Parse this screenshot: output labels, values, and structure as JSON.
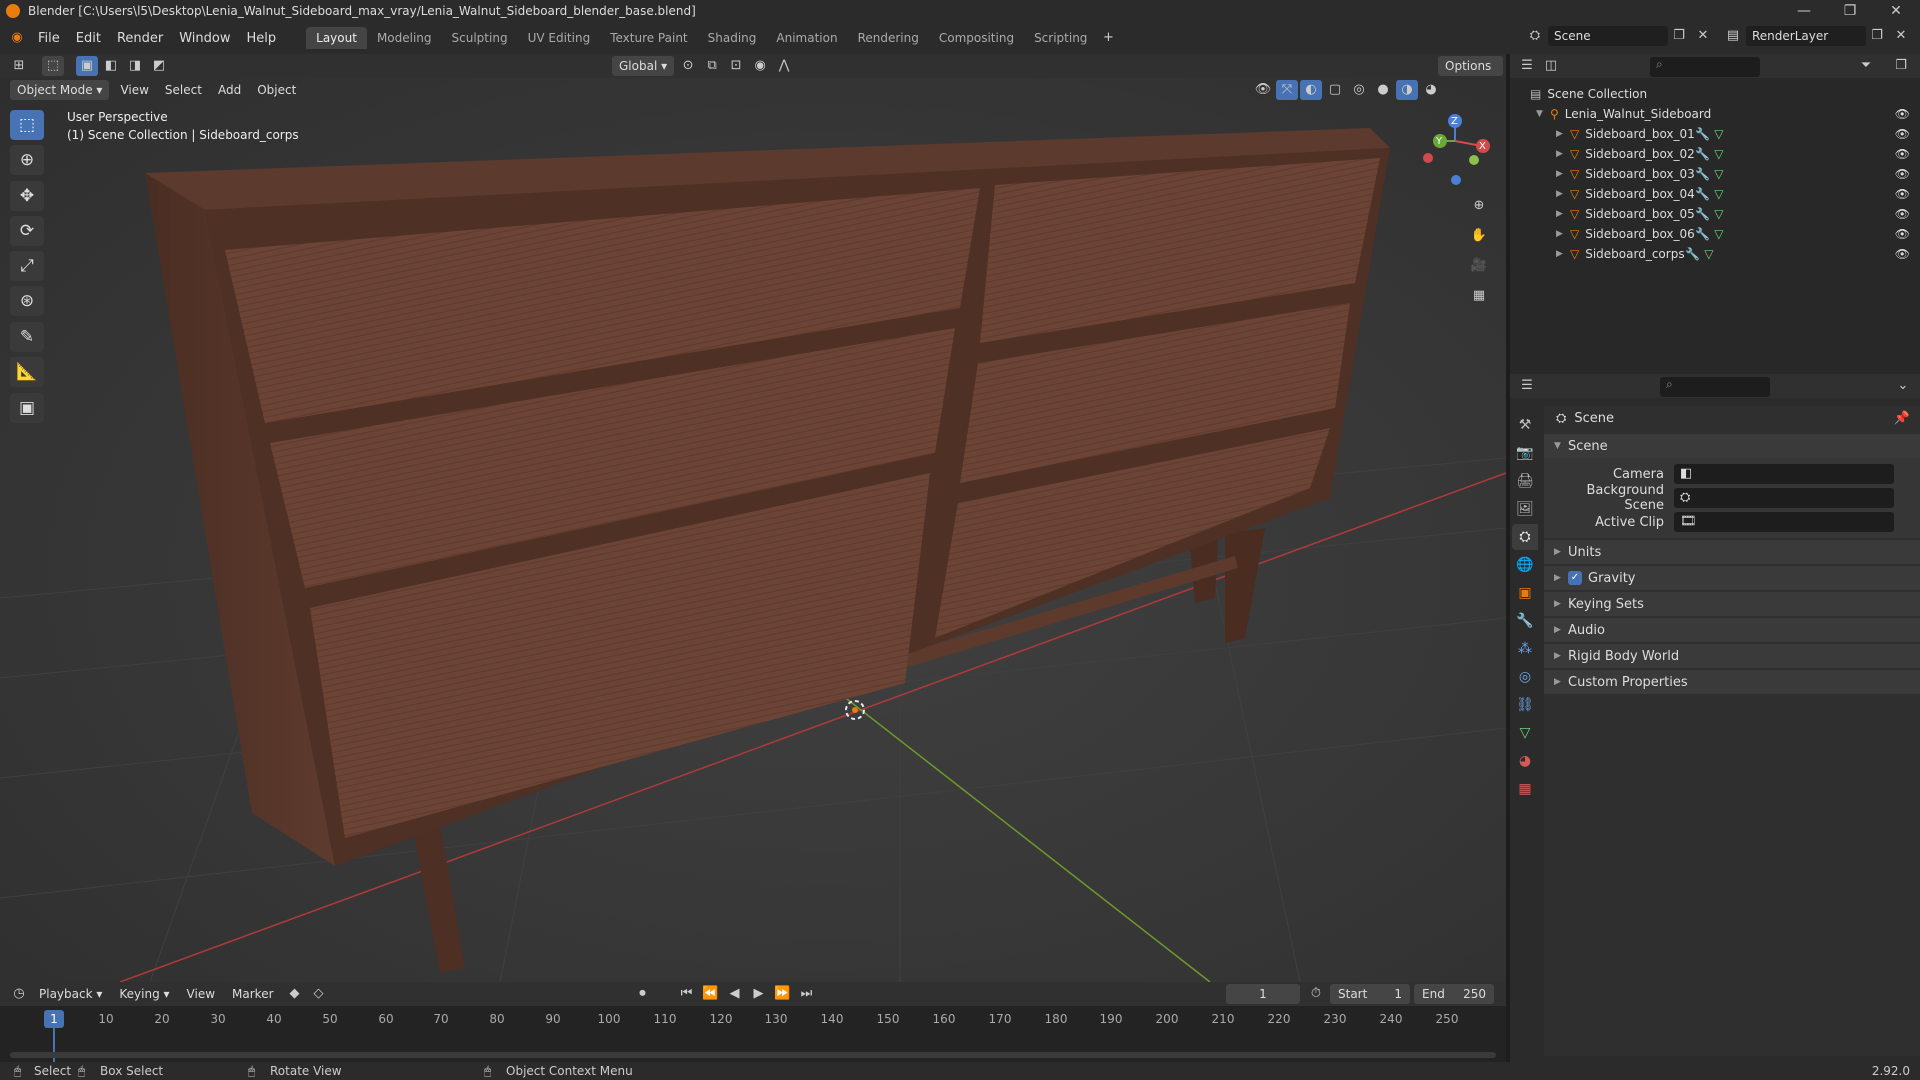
{
  "window": {
    "title": "Blender [C:\\Users\\l5\\Desktop\\Lenia_Walnut_Sideboard_max_vray/Lenia_Walnut_Sideboard_blender_base.blend]"
  },
  "menu": {
    "items": [
      "File",
      "Edit",
      "Render",
      "Window",
      "Help"
    ]
  },
  "workspaces": [
    "Layout",
    "Modeling",
    "Sculpting",
    "UV Editing",
    "Texture Paint",
    "Shading",
    "Animation",
    "Rendering",
    "Compositing",
    "Scripting"
  ],
  "topbar": {
    "scene": "Scene",
    "render_layer": "RenderLayer"
  },
  "viewport_header": {
    "transform_orientation": "Global",
    "options_label": "Options",
    "mode": "Object Mode",
    "menus": [
      "View",
      "Select",
      "Add",
      "Object"
    ]
  },
  "viewport": {
    "perspective_label": "User Perspective",
    "collection_label": "(1) Scene Collection | Sideboard_corps"
  },
  "gizmo": {
    "x": "X",
    "y": "Y",
    "z": "Z"
  },
  "outliner": {
    "root": "Scene Collection",
    "collection": "Lenia_Walnut_Sideboard",
    "objects": [
      "Sideboard_box_01",
      "Sideboard_box_02",
      "Sideboard_box_03",
      "Sideboard_box_04",
      "Sideboard_box_05",
      "Sideboard_box_06",
      "Sideboard_corps"
    ]
  },
  "properties": {
    "context": "Scene",
    "panel": "Scene",
    "fields": {
      "camera": "Camera",
      "background_scene": "Background Scene",
      "active_clip": "Active Clip"
    },
    "subpanels": [
      "Units",
      "Gravity",
      "Keying Sets",
      "Audio",
      "Rigid Body World",
      "Custom Properties"
    ],
    "gravity_checked": true
  },
  "timeline": {
    "menus": [
      "Playback",
      "Keying",
      "View",
      "Marker"
    ],
    "current_frame": "1",
    "start_label": "Start",
    "start": "1",
    "end_label": "End",
    "end": "250",
    "ruler": [
      "1",
      "10",
      "20",
      "30",
      "40",
      "50",
      "60",
      "70",
      "80",
      "90",
      "100",
      "110",
      "120",
      "130",
      "140",
      "150",
      "160",
      "170",
      "180",
      "190",
      "200",
      "210",
      "220",
      "230",
      "240",
      "250"
    ]
  },
  "status": {
    "select": "Select",
    "box_select": "Box Select",
    "rotate": "Rotate View",
    "context_menu": "Object Context Menu",
    "version": "2.92.0"
  },
  "colors": {
    "accent": "#4772b3",
    "orange": "#e87d0d",
    "wood": "#6b4435"
  }
}
